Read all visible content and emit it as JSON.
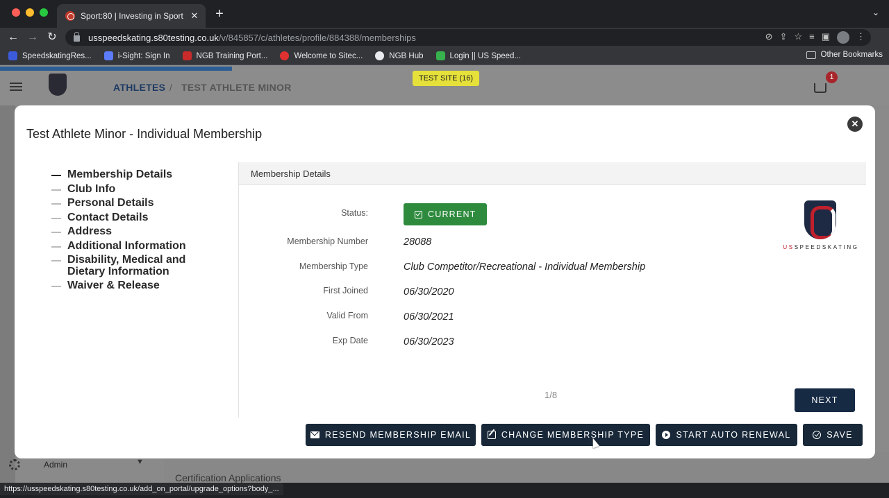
{
  "browser": {
    "tab_title": "Sport:80 | Investing in Sport",
    "tab_close": "✕",
    "new_tab": "+",
    "url_host": "usspeedskating.s80testing.co.uk",
    "url_path": "/v/845857/c/athletes/profile/884388/memberships",
    "bookmarks": [
      {
        "label": "SpeedskatingRes...",
        "color": "#3b5bdb"
      },
      {
        "label": "i-Sight: Sign In",
        "color": "#5c7cfa"
      },
      {
        "label": "NGB Training Port...",
        "color": "#c92a2a"
      },
      {
        "label": "Welcome to Sitec...",
        "color": "#e03131"
      },
      {
        "label": "NGB Hub",
        "color": "#e8eaed"
      },
      {
        "label": "Login || US Speed...",
        "color": "#37b24d"
      }
    ],
    "other_bookmarks": "Other Bookmarks",
    "status_url": "https://usspeedskating.s80testing.co.uk/add_on_portal/upgrade_options?body_..."
  },
  "app": {
    "breadcrumb_root": "ATHLETES",
    "breadcrumb_sep": "/",
    "breadcrumb_current": "TEST ATHLETE MINOR",
    "test_site_badge": "TEST SITE (16)",
    "cart_count": "1",
    "admin_label": "Admin",
    "certification_applications": "Certification Applications"
  },
  "modal": {
    "title": "Test Athlete Minor - Individual Membership",
    "close": "✕",
    "steps": [
      {
        "label": "Membership Details",
        "active": true
      },
      {
        "label": "Club Info",
        "active": false
      },
      {
        "label": "Personal Details",
        "active": false
      },
      {
        "label": "Contact Details",
        "active": false
      },
      {
        "label": "Address",
        "active": false
      },
      {
        "label": "Additional Information",
        "active": false
      },
      {
        "label": "Disability, Medical and Dietary Information",
        "active": false
      },
      {
        "label": "Waiver & Release",
        "active": false
      }
    ],
    "panel_title": "Membership Details",
    "fields": {
      "status_label": "Status:",
      "status_value": "CURRENT",
      "membership_number_label": "Membership Number",
      "membership_number_value": "28088",
      "membership_type_label": "Membership Type",
      "membership_type_value": "Club Competitor/Recreational - Individual Membership",
      "first_joined_label": "First Joined",
      "first_joined_value": "06/30/2020",
      "valid_from_label": "Valid From",
      "valid_from_value": "06/30/2021",
      "exp_date_label": "Exp Date",
      "exp_date_value": "06/30/2023"
    },
    "brand_text_us": "US",
    "brand_text_rest": "SPEEDSKATING",
    "pager": "1/8",
    "next_label": "NEXT",
    "actions": {
      "resend": "RESEND MEMBERSHIP EMAIL",
      "change": "CHANGE MEMBERSHIP TYPE",
      "renew": "START AUTO RENEWAL",
      "save": "SAVE"
    }
  },
  "colors": {
    "status_green": "#2e8b3e",
    "button_navy": "#182838",
    "next_navy": "#162a44",
    "test_site_yellow": "#e6e13a"
  }
}
